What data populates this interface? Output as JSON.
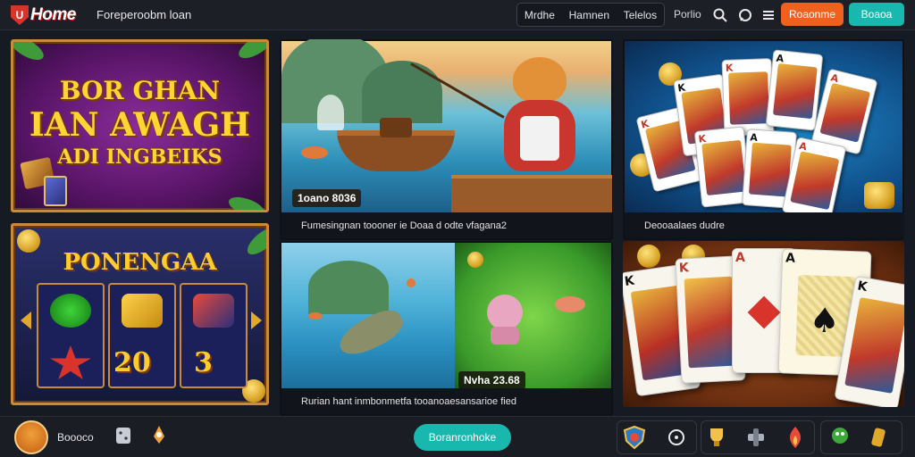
{
  "header": {
    "logo_mark": "U",
    "logo_text": "Home",
    "site_title": "Foreperoobm loan",
    "nav": [
      "Mrdhe",
      "Hamnen",
      "Telelos"
    ],
    "nav_plain": "Porlio",
    "primary_button": "Roaonme",
    "secondary_button": "Boaoa"
  },
  "tiles": {
    "t1": {
      "line1": "BOR GHAN",
      "line2": "IAN AWAGH",
      "line3": "ADI INGBEIKS"
    },
    "t2": {
      "overlay": "1oano 8036",
      "caption": "Fumesingnan toooner ie Doaa d odte vfagana2"
    },
    "t3": {
      "caption": "Deooaalaes dudre"
    },
    "t4": {
      "title": "PONENGAA",
      "number": "20",
      "number2": "3"
    },
    "t5": {
      "overlay": "Nvha 23.68",
      "caption": "Rurian hant inmbonmetfa tooanoaesansarioe fied"
    }
  },
  "cards": [
    "K",
    "K",
    "K",
    "A",
    "A",
    "K",
    "A",
    "A"
  ],
  "bottom": {
    "label": "Boooco",
    "center_button": "Boranronhoke"
  },
  "colors": {
    "accent_orange": "#f0611e",
    "accent_teal": "#18b8ae",
    "frame_gold": "#c98a3a"
  }
}
